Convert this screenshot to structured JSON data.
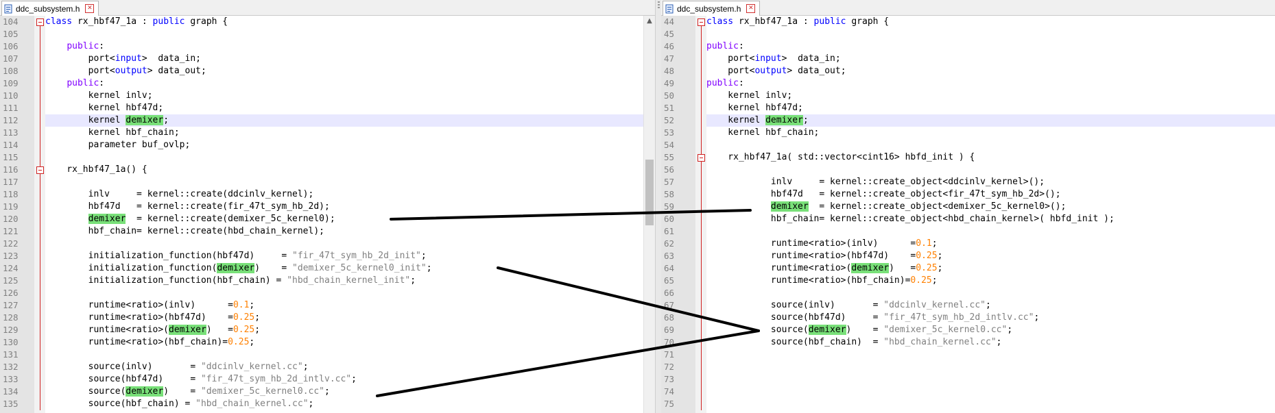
{
  "left": {
    "tab_title": "ddc_subsystem.h",
    "lines": [
      {
        "n": "104",
        "fold": "open",
        "parts": [
          [
            "kw2",
            "class"
          ],
          [
            "plain",
            " rx_hbf47_1a : "
          ],
          [
            "kw2",
            "public"
          ],
          [
            "plain",
            " graph {"
          ]
        ]
      },
      {
        "n": "105",
        "parts": []
      },
      {
        "n": "106",
        "parts": [
          [
            "plain",
            "    "
          ],
          [
            "kw",
            "public"
          ],
          [
            "plain",
            ":"
          ]
        ]
      },
      {
        "n": "107",
        "parts": [
          [
            "plain",
            "        port<"
          ],
          [
            "kw2",
            "input"
          ],
          [
            "plain",
            ">  data_in;"
          ]
        ]
      },
      {
        "n": "108",
        "parts": [
          [
            "plain",
            "        port<"
          ],
          [
            "kw2",
            "output"
          ],
          [
            "plain",
            "> data_out;"
          ]
        ]
      },
      {
        "n": "109",
        "parts": [
          [
            "plain",
            "    "
          ],
          [
            "kw",
            "public"
          ],
          [
            "plain",
            ":"
          ]
        ]
      },
      {
        "n": "110",
        "parts": [
          [
            "plain",
            "        kernel inlv;"
          ]
        ]
      },
      {
        "n": "111",
        "parts": [
          [
            "plain",
            "        kernel hbf47d;"
          ]
        ]
      },
      {
        "n": "112",
        "hl": true,
        "parts": [
          [
            "plain",
            "        kernel "
          ],
          [
            "mark",
            "demixer"
          ],
          [
            "plain",
            ";"
          ]
        ]
      },
      {
        "n": "113",
        "parts": [
          [
            "plain",
            "        kernel hbf_chain;"
          ]
        ]
      },
      {
        "n": "114",
        "parts": [
          [
            "plain",
            "        parameter buf_ovlp;"
          ]
        ]
      },
      {
        "n": "115",
        "parts": []
      },
      {
        "n": "116",
        "fold": "open",
        "parts": [
          [
            "plain",
            "    rx_hbf47_1a() {"
          ]
        ]
      },
      {
        "n": "117",
        "parts": []
      },
      {
        "n": "118",
        "parts": [
          [
            "plain",
            "        inlv     = kernel::create(ddcinlv_kernel);"
          ]
        ]
      },
      {
        "n": "119",
        "parts": [
          [
            "plain",
            "        hbf47d   = kernel::create(fir_47t_sym_hb_2d);"
          ]
        ]
      },
      {
        "n": "120",
        "parts": [
          [
            "plain",
            "        "
          ],
          [
            "mark",
            "demixer"
          ],
          [
            "plain",
            "  = kernel::create(demixer_5c_kernel0);"
          ]
        ]
      },
      {
        "n": "121",
        "parts": [
          [
            "plain",
            "        hbf_chain= kernel::create(hbd_chain_kernel);"
          ]
        ]
      },
      {
        "n": "122",
        "parts": []
      },
      {
        "n": "123",
        "parts": [
          [
            "plain",
            "        initialization_function(hbf47d)     = "
          ],
          [
            "str",
            "\"fir_47t_sym_hb_2d_init\""
          ],
          [
            "plain",
            ";"
          ]
        ]
      },
      {
        "n": "124",
        "parts": [
          [
            "plain",
            "        initialization_function("
          ],
          [
            "mark",
            "demixer"
          ],
          [
            "plain",
            ")    = "
          ],
          [
            "str",
            "\"demixer_5c_kernel0_init\""
          ],
          [
            "plain",
            ";"
          ]
        ]
      },
      {
        "n": "125",
        "parts": [
          [
            "plain",
            "        initialization_function(hbf_chain) = "
          ],
          [
            "str",
            "\"hbd_chain_kernel_init\""
          ],
          [
            "plain",
            ";"
          ]
        ]
      },
      {
        "n": "126",
        "parts": []
      },
      {
        "n": "127",
        "parts": [
          [
            "plain",
            "        runtime<ratio>(inlv)      ="
          ],
          [
            "num",
            "0.1"
          ],
          [
            "plain",
            ";"
          ]
        ]
      },
      {
        "n": "128",
        "parts": [
          [
            "plain",
            "        runtime<ratio>(hbf47d)    ="
          ],
          [
            "num",
            "0.25"
          ],
          [
            "plain",
            ";"
          ]
        ]
      },
      {
        "n": "129",
        "parts": [
          [
            "plain",
            "        runtime<ratio>("
          ],
          [
            "mark",
            "demixer"
          ],
          [
            "plain",
            ")   ="
          ],
          [
            "num",
            "0.25"
          ],
          [
            "plain",
            ";"
          ]
        ]
      },
      {
        "n": "130",
        "parts": [
          [
            "plain",
            "        runtime<ratio>(hbf_chain)="
          ],
          [
            "num",
            "0.25"
          ],
          [
            "plain",
            ";"
          ]
        ]
      },
      {
        "n": "131",
        "parts": []
      },
      {
        "n": "132",
        "parts": [
          [
            "plain",
            "        source(inlv)       = "
          ],
          [
            "str",
            "\"ddcinlv_kernel.cc\""
          ],
          [
            "plain",
            ";"
          ]
        ]
      },
      {
        "n": "133",
        "parts": [
          [
            "plain",
            "        source(hbf47d)     = "
          ],
          [
            "str",
            "\"fir_47t_sym_hb_2d_intlv.cc\""
          ],
          [
            "plain",
            ";"
          ]
        ]
      },
      {
        "n": "134",
        "parts": [
          [
            "plain",
            "        source("
          ],
          [
            "mark",
            "demixer"
          ],
          [
            "plain",
            ")    = "
          ],
          [
            "str",
            "\"demixer_5c_kernel0.cc\""
          ],
          [
            "plain",
            ";"
          ]
        ]
      },
      {
        "n": "135",
        "parts": [
          [
            "plain",
            "        source(hbf_chain) = "
          ],
          [
            "str",
            "\"hbd_chain_kernel.cc\""
          ],
          [
            "plain",
            ";"
          ]
        ]
      }
    ]
  },
  "right": {
    "tab_title": "ddc_subsystem.h",
    "lines": [
      {
        "n": "44",
        "fold": "open",
        "parts": [
          [
            "kw2",
            "class"
          ],
          [
            "plain",
            " rx_hbf47_1a : "
          ],
          [
            "kw2",
            "public"
          ],
          [
            "plain",
            " graph {"
          ]
        ]
      },
      {
        "n": "45",
        "parts": []
      },
      {
        "n": "46",
        "parts": [
          [
            "kw",
            "public"
          ],
          [
            "plain",
            ":"
          ]
        ]
      },
      {
        "n": "47",
        "parts": [
          [
            "plain",
            "    port<"
          ],
          [
            "kw2",
            "input"
          ],
          [
            "plain",
            ">  data_in;"
          ]
        ]
      },
      {
        "n": "48",
        "parts": [
          [
            "plain",
            "    port<"
          ],
          [
            "kw2",
            "output"
          ],
          [
            "plain",
            "> data_out;"
          ]
        ]
      },
      {
        "n": "49",
        "parts": [
          [
            "kw",
            "public"
          ],
          [
            "plain",
            ":"
          ]
        ]
      },
      {
        "n": "50",
        "parts": [
          [
            "plain",
            "    kernel inlv;"
          ]
        ]
      },
      {
        "n": "51",
        "parts": [
          [
            "plain",
            "    kernel hbf47d;"
          ]
        ]
      },
      {
        "n": "52",
        "hl": true,
        "parts": [
          [
            "plain",
            "    kernel "
          ],
          [
            "mark",
            "demixer"
          ],
          [
            "plain",
            ";"
          ]
        ]
      },
      {
        "n": "53",
        "parts": [
          [
            "plain",
            "    kernel hbf_chain;"
          ]
        ]
      },
      {
        "n": "54",
        "parts": []
      },
      {
        "n": "55",
        "fold": "open",
        "parts": [
          [
            "plain",
            "    rx_hbf47_1a( std::vector<cint16> hbfd_init ) {"
          ]
        ]
      },
      {
        "n": "56",
        "parts": []
      },
      {
        "n": "57",
        "parts": [
          [
            "plain",
            "            inlv     = kernel::create_object<ddcinlv_kernel>();"
          ]
        ]
      },
      {
        "n": "58",
        "parts": [
          [
            "plain",
            "            hbf47d   = kernel::create_object<fir_47t_sym_hb_2d>();"
          ]
        ]
      },
      {
        "n": "59",
        "parts": [
          [
            "plain",
            "            "
          ],
          [
            "mark",
            "demixer"
          ],
          [
            "plain",
            "  = kernel::create_object<demixer_5c_kernel0>();"
          ]
        ]
      },
      {
        "n": "60",
        "parts": [
          [
            "plain",
            "            hbf_chain= kernel::create_object<hbd_chain_kernel>( hbfd_init );"
          ]
        ]
      },
      {
        "n": "61",
        "parts": []
      },
      {
        "n": "62",
        "parts": [
          [
            "plain",
            "            runtime<ratio>(inlv)      ="
          ],
          [
            "num",
            "0.1"
          ],
          [
            "plain",
            ";"
          ]
        ]
      },
      {
        "n": "63",
        "parts": [
          [
            "plain",
            "            runtime<ratio>(hbf47d)    ="
          ],
          [
            "num",
            "0.25"
          ],
          [
            "plain",
            ";"
          ]
        ]
      },
      {
        "n": "64",
        "parts": [
          [
            "plain",
            "            runtime<ratio>("
          ],
          [
            "mark",
            "demixer"
          ],
          [
            "plain",
            ")   ="
          ],
          [
            "num",
            "0.25"
          ],
          [
            "plain",
            ";"
          ]
        ]
      },
      {
        "n": "65",
        "parts": [
          [
            "plain",
            "            runtime<ratio>(hbf_chain)="
          ],
          [
            "num",
            "0.25"
          ],
          [
            "plain",
            ";"
          ]
        ]
      },
      {
        "n": "66",
        "parts": []
      },
      {
        "n": "67",
        "parts": [
          [
            "plain",
            "            source(inlv)       = "
          ],
          [
            "str",
            "\"ddcinlv_kernel.cc\""
          ],
          [
            "plain",
            ";"
          ]
        ]
      },
      {
        "n": "68",
        "parts": [
          [
            "plain",
            "            source(hbf47d)     = "
          ],
          [
            "str",
            "\"fir_47t_sym_hb_2d_intlv.cc\""
          ],
          [
            "plain",
            ";"
          ]
        ]
      },
      {
        "n": "69",
        "parts": [
          [
            "plain",
            "            source("
          ],
          [
            "mark",
            "demixer"
          ],
          [
            "plain",
            ")    = "
          ],
          [
            "str",
            "\"demixer_5c_kernel0.cc\""
          ],
          [
            "plain",
            ";"
          ]
        ]
      },
      {
        "n": "70",
        "parts": [
          [
            "plain",
            "            source(hbf_chain)  = "
          ],
          [
            "str",
            "\"hbd_chain_kernel.cc\""
          ],
          [
            "plain",
            ";"
          ]
        ]
      },
      {
        "n": "71",
        "parts": []
      },
      {
        "n": "72",
        "parts": []
      },
      {
        "n": "73",
        "parts": []
      },
      {
        "n": "74",
        "parts": []
      },
      {
        "n": "75",
        "parts": []
      }
    ]
  },
  "colors": {
    "keyword": "#8000ff",
    "type_keyword": "#0000ff",
    "string": "#808080",
    "number": "#ff8000",
    "highlight_mark": "#79e079",
    "current_line": "#e8e8ff",
    "annotation_line": "#000000"
  },
  "icons": {
    "file": "file-icon",
    "close": "close-icon",
    "fold": "fold-minus-icon"
  }
}
